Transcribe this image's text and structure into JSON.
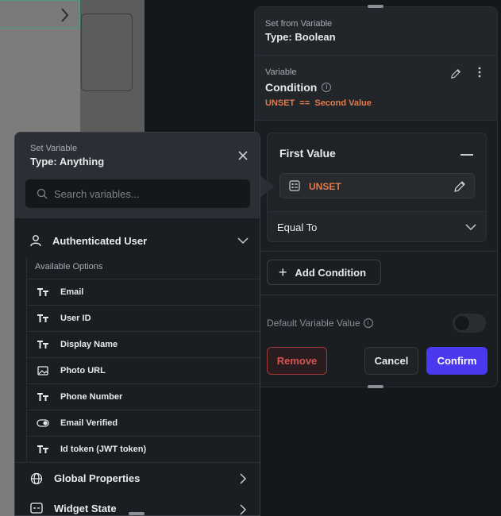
{
  "right_panel": {
    "header_label": "Set from Variable",
    "header_type": "Type: Boolean",
    "variable_label": "Variable",
    "condition_title": "Condition",
    "condition_expression": "UNSET  ==  Second Value",
    "first_value_title": "First Value",
    "unset_value": "UNSET",
    "operator": "Equal To",
    "add_condition_label": "Add Condition",
    "default_value_label": "Default Variable Value",
    "remove_label": "Remove",
    "cancel_label": "Cancel",
    "confirm_label": "Confirm"
  },
  "left_panel": {
    "header_label": "Set Variable",
    "header_type": "Type: Anything",
    "search_placeholder": "Search variables...",
    "sections": {
      "authenticated_user": "Authenticated User",
      "available_options": "Available Options",
      "global_properties": "Global Properties",
      "widget_state": "Widget State"
    },
    "options": [
      {
        "label": "Email",
        "icon": "text-type-icon"
      },
      {
        "label": "User ID",
        "icon": "text-type-icon"
      },
      {
        "label": "Display Name",
        "icon": "text-type-icon"
      },
      {
        "label": "Photo URL",
        "icon": "image-icon"
      },
      {
        "label": "Phone Number",
        "icon": "text-type-icon"
      },
      {
        "label": "Email Verified",
        "icon": "toggle-icon"
      },
      {
        "label": "Id token (JWT token)",
        "icon": "text-type-icon"
      }
    ]
  },
  "colors": {
    "accent": "#4b39ef",
    "unset_orange": "#e07b4a",
    "remove_red": "#d9534f"
  }
}
